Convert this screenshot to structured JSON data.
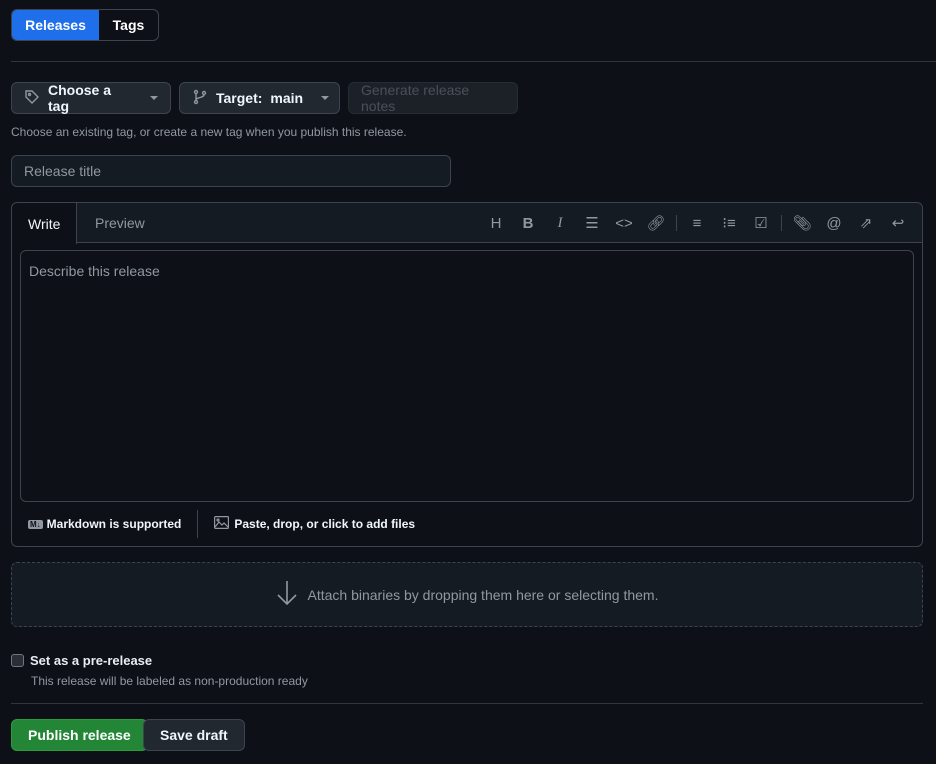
{
  "tabs": {
    "releases": "Releases",
    "tags": "Tags"
  },
  "toolbar": {
    "choose_tag": "Choose a tag",
    "target_label": "Target:",
    "target_value": "main",
    "generate_notes": "Generate release notes"
  },
  "tag_hint": "Choose an existing tag, or create a new tag when you publish this release.",
  "title_input": {
    "placeholder": "Release title",
    "value": ""
  },
  "editor": {
    "write": "Write",
    "preview": "Preview",
    "placeholder": "Describe this release",
    "markdown": "Markdown is supported",
    "attach": "Paste, drop, or click to add files"
  },
  "binaries": "Attach binaries by dropping them here or selecting them.",
  "prerelease": {
    "label": "Set as a pre-release",
    "hint": "This release will be labeled as non-production ready",
    "checked": false
  },
  "actions": {
    "publish": "Publish release",
    "draft": "Save draft"
  },
  "colors": {
    "bg": "#0d1117",
    "accent": "#1f6feb",
    "publish": "#238636"
  }
}
